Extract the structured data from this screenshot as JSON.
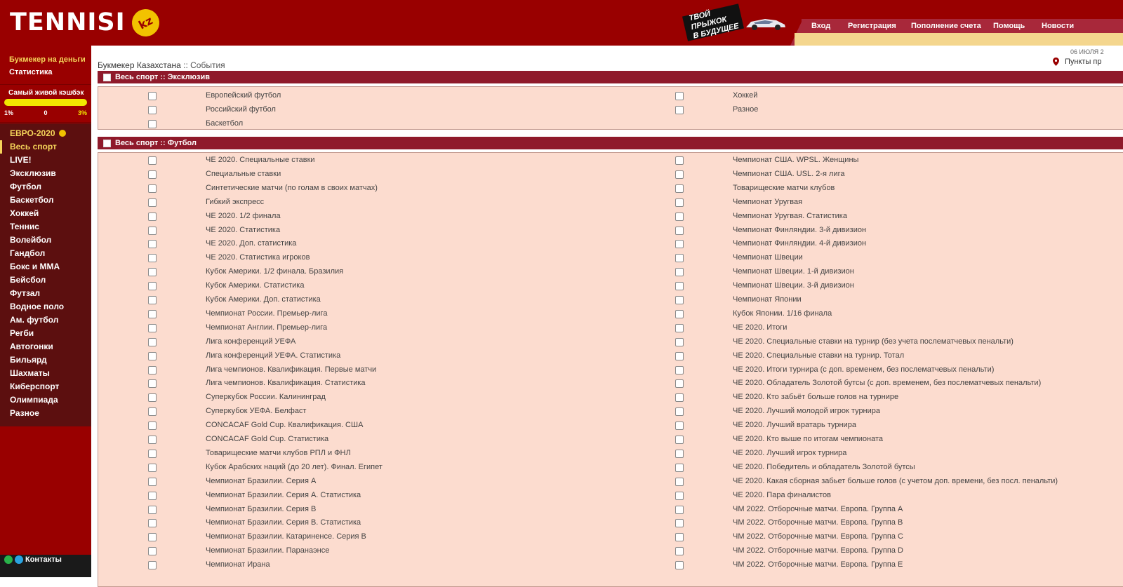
{
  "brand": {
    "name": "TENNISI",
    "badge": "kz"
  },
  "promo": {
    "line1": "ТВОЙ ПРЫЖОК",
    "line2": "В БУДУЩЕЕ"
  },
  "nav": [
    "Вход",
    "Регистрация",
    "Пополнение счета",
    "Помощь",
    "Новости"
  ],
  "sidebar": {
    "top_links": [
      "Букмекер на деньги",
      "Статистика"
    ],
    "cashback": {
      "title": "Самый живой кэшбэк",
      "min": "1%",
      "mid": "0",
      "max": "3%"
    },
    "sports": [
      "ЕВРО-2020",
      "Весь спорт",
      "LIVE!",
      "Эксклюзив",
      "Футбол",
      "Баскетбол",
      "Хоккей",
      "Теннис",
      "Волейбол",
      "Гандбол",
      "Бокс и ММА",
      "Бейсбол",
      "Футзал",
      "Водное поло",
      "Ам. футбол",
      "Регби",
      "Автогонки",
      "Бильярд",
      "Шахматы",
      "Киберспорт",
      "Олимпиада",
      "Разное"
    ],
    "contacts": "Контакты"
  },
  "breadcrumb": {
    "root": "Букмекер Казахстана",
    "sep": "::",
    "current": "События"
  },
  "date": "06 ИЮЛЯ 2",
  "points_label": "Пункты пр",
  "sections": [
    {
      "title": "Весь спорт :: Эксклюзив",
      "col1": [
        "Европейский футбол",
        "Российский футбол",
        "Баскетбол"
      ],
      "col2": [
        "Хоккей",
        "Разное"
      ]
    },
    {
      "title": "Весь спорт :: Футбол",
      "col1": [
        "ЧЕ 2020. Специальные ставки",
        "Специальные ставки",
        "Синтетические матчи (по голам в своих матчах)",
        "Гибкий экспресс",
        "ЧЕ 2020. 1/2 финала",
        "ЧЕ 2020. Статистика",
        "ЧЕ 2020. Доп. статистика",
        "ЧЕ 2020. Статистика игроков",
        "Кубок Америки. 1/2 финала. Бразилия",
        "Кубок Америки. Статистика",
        "Кубок Америки. Доп. статистика",
        "Чемпионат России. Премьер-лига",
        "Чемпионат Англии. Премьер-лига",
        "Лига конференций УЕФА",
        "Лига конференций УЕФА. Статистика",
        "Лига чемпионов. Квалификация. Первые матчи",
        "Лига чемпионов. Квалификация. Статистика",
        "Суперкубок России. Калининград",
        "Суперкубок УЕФА. Белфаст",
        "CONCACAF Gold Cup. Квалификация. США",
        "CONCACAF Gold Cup. Статистика",
        "Товарищеские матчи клубов РПЛ и ФНЛ",
        "Кубок Арабских наций (до 20 лет). Финал. Египет",
        "Чемпионат Бразилии. Серия А",
        "Чемпионат Бразилии. Серия А. Статистика",
        "Чемпионат Бразилии. Серия В",
        "Чемпионат Бразилии. Серия В. Статистика",
        "Чемпионат Бразилии. Катариненсе. Серия В",
        "Чемпионат Бразилии. Паранаэнсе",
        "Чемпионат Ирана"
      ],
      "col2": [
        "Чемпионат США. WPSL. Женщины",
        "Чемпионат США. USL. 2-я лига",
        "Товарищеские матчи клубов",
        "Чемпионат Уругвая",
        "Чемпионат Уругвая. Статистика",
        "Чемпионат Финляндии. 3-й дивизион",
        "Чемпионат Финляндии. 4-й дивизион",
        "Чемпионат Швеции",
        "Чемпионат Швеции. 1-й дивизион",
        "Чемпионат Швеции. 3-й дивизион",
        "Чемпионат Японии",
        "Кубок Японии. 1/16 финала",
        "ЧЕ 2020. Итоги",
        "ЧЕ 2020. Специальные ставки на турнир (без учета послематчевых пенальти)",
        "ЧЕ 2020. Специальные ставки на турнир. Тотал",
        "ЧЕ 2020. Итоги турнира (с доп. временем, без послематчевых пенальти)",
        "ЧЕ 2020. Обладатель Золотой бутсы (с доп. временем, без послематчевых пенальти)",
        "ЧЕ 2020. Кто забьёт больше голов на турнире",
        "ЧЕ 2020. Лучший молодой игрок турнира",
        "ЧЕ 2020. Лучший вратарь турнира",
        "ЧЕ 2020. Кто выше по итогам чемпионата",
        "ЧЕ 2020. Лучший игрок турнира",
        "ЧЕ 2020. Победитель и обладатель Золотой бутсы",
        "ЧЕ 2020. Какая сборная забьет больше голов (с учетом доп. времени, без посл. пенальти)",
        "ЧЕ 2020. Пара финалистов",
        "ЧМ 2022. Отборочные матчи. Европа. Группа A",
        "ЧМ 2022. Отборочные матчи. Европа. Группа B",
        "ЧМ 2022. Отборочные матчи. Европа. Группа C",
        "ЧМ 2022. Отборочные матчи. Европа. Группа D",
        "ЧМ 2022. Отборочные матчи. Европа. Группа E"
      ]
    }
  ],
  "colors": {
    "brand_red": "#990000",
    "sidebar_dark": "#5c0f0f",
    "section_head": "#8f1a2b",
    "panel_bg": "#fcdccf",
    "accent_yellow": "#f5d45a"
  }
}
